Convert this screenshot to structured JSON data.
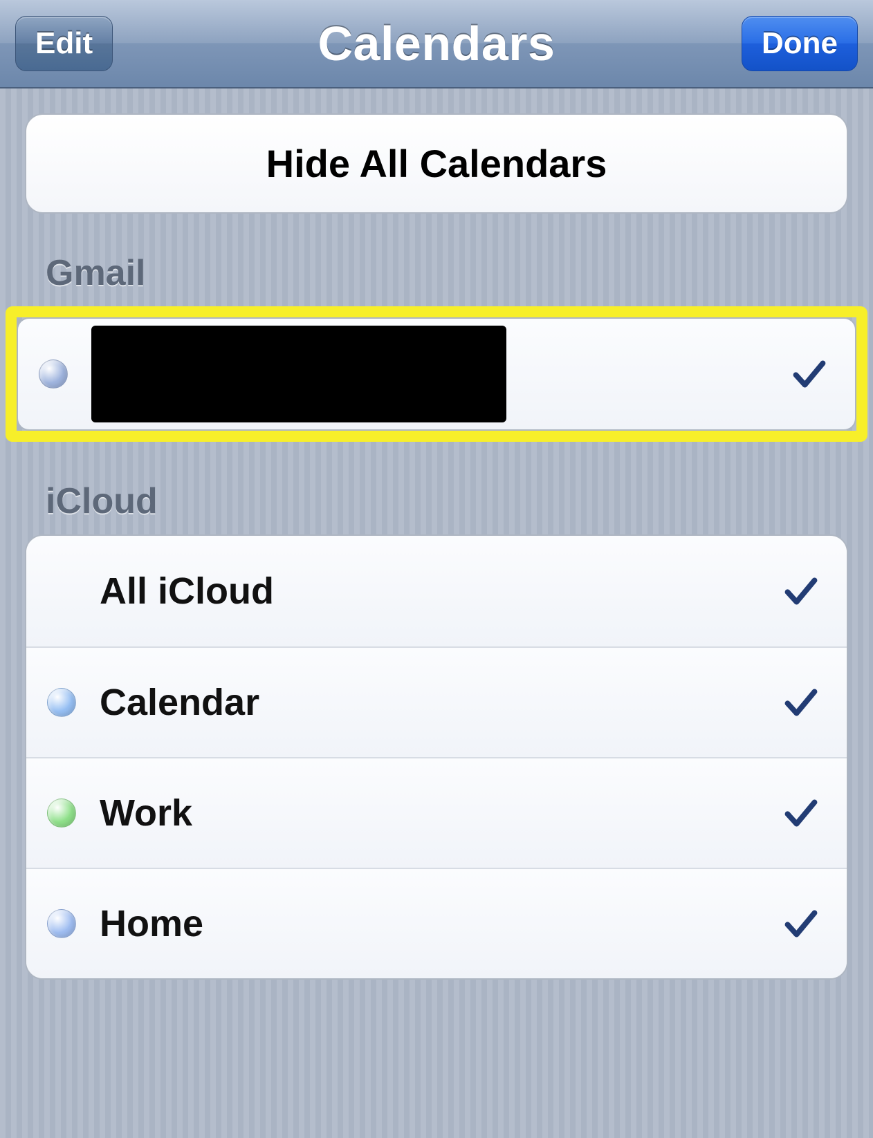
{
  "nav": {
    "edit_label": "Edit",
    "title": "Calendars",
    "done_label": "Done"
  },
  "hide_all_label": "Hide All Calendars",
  "sections": {
    "gmail": {
      "header": "Gmail",
      "items": [
        {
          "label": "",
          "redacted": true,
          "checked": true,
          "color": "#9fb4de"
        }
      ]
    },
    "icloud": {
      "header": "iCloud",
      "items": [
        {
          "label": "All iCloud",
          "checked": true,
          "color": null
        },
        {
          "label": "Calendar",
          "checked": true,
          "color": "#96bff3"
        },
        {
          "label": "Work",
          "checked": true,
          "color": "#8fe08a"
        },
        {
          "label": "Home",
          "checked": true,
          "color": "#9fbdf1"
        }
      ]
    }
  },
  "check_color": "#223c74"
}
